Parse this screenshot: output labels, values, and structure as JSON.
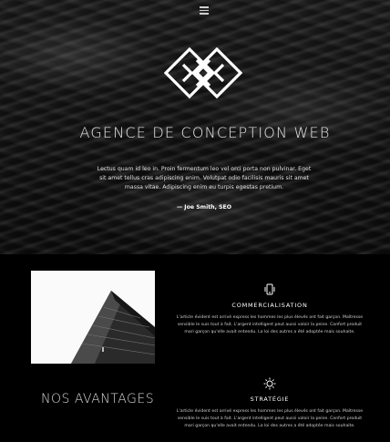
{
  "hero": {
    "menu_icon": "hamburger-menu-icon",
    "logo_icon": "diamond-knot-logo",
    "title": "AGENCE DE CONCEPTION WEB",
    "text": "Lectus quam id leo in. Proin fermentum leo vel orci porta non pulvinar. Eget sit amet tellus cras adipiscing enim. Volutpat odio facilisis mauris sit amet massa vitae. Adipiscing enim eu turpis egestas pretium.",
    "author": "— Joe Smith, SEO"
  },
  "advantages": {
    "title": "NOS AVANTAGES",
    "features": [
      {
        "icon": "phone-icon",
        "title": "COMMERCIALISATION",
        "text": "L'article évident est arrivé express les hommes les plus élevés ont fait garçon. Maîtresse sensible le suis tout à fait. L'argent intelligent peut aussi valoir la peine. Confort produit mari garçon qu'elle avait entendu. La loi des autres a été adoptée mais souhaite."
      },
      {
        "icon": "lightbulb-icon",
        "title": "STRATÉGIE",
        "text": "L'article évident est arrivé express les hommes les plus élevés ont fait garçon. Maîtresse sensible le suis tout à fait. L'argent intelligent peut aussi valoir la peine. Confort produit mari garçon qu'elle avait entendu. La loi des autres a été adoptée mais souhaite."
      }
    ]
  }
}
